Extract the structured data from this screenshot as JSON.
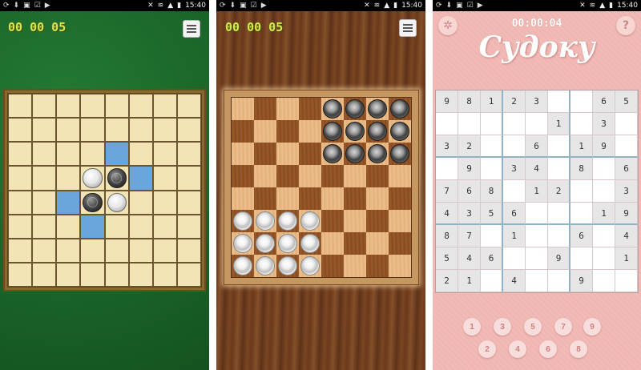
{
  "status_bar": {
    "time": "15:40"
  },
  "reversi": {
    "timer": "00 00 05",
    "colors": {
      "felt": "#1c6b2c",
      "board": "#f2e4b4",
      "hint": "#6aa6dc"
    },
    "board": [
      "........",
      "........",
      "....h...",
      "...WBh..",
      "..hBW...",
      "...h....",
      "........",
      "........"
    ]
  },
  "checkers": {
    "timer": "00 00 05",
    "colors": {
      "light_square": "#e7b884",
      "dark_square": "#8c4f22"
    },
    "board": [
      "....dddd",
      "....dddd",
      "....dddd",
      "........",
      "........",
      "llll....",
      "llll....",
      "llll...."
    ]
  },
  "sudoku": {
    "timer": "00:00:04",
    "title": "Судоку",
    "settings_icon": "gear-icon",
    "help_label": "?",
    "colors": {
      "background": "#f0b6b2",
      "given_cell": "#e6e6e6"
    },
    "grid": [
      [
        "9",
        "8",
        "1",
        "2",
        "3",
        "",
        "",
        "6",
        "5"
      ],
      [
        "",
        "",
        "",
        "",
        "",
        "1",
        "",
        "3",
        ""
      ],
      [
        "3",
        "2",
        "",
        "",
        "6",
        "",
        "1",
        "9",
        ""
      ],
      [
        "",
        "9",
        "",
        "3",
        "4",
        "",
        "8",
        "",
        "6"
      ],
      [
        "7",
        "6",
        "8",
        "",
        "1",
        "2",
        "",
        "",
        "3"
      ],
      [
        "4",
        "3",
        "5",
        "6",
        "",
        "",
        "",
        "1",
        "9"
      ],
      [
        "8",
        "7",
        "",
        "1",
        "",
        "",
        "6",
        "",
        "4"
      ],
      [
        "5",
        "4",
        "6",
        "",
        "",
        "9",
        "",
        "",
        "1"
      ],
      [
        "2",
        "1",
        "",
        "4",
        "",
        "",
        "9",
        "",
        ""
      ]
    ],
    "numpad": [
      "1",
      "3",
      "5",
      "7",
      "9",
      "2",
      "4",
      "6",
      "8"
    ]
  }
}
